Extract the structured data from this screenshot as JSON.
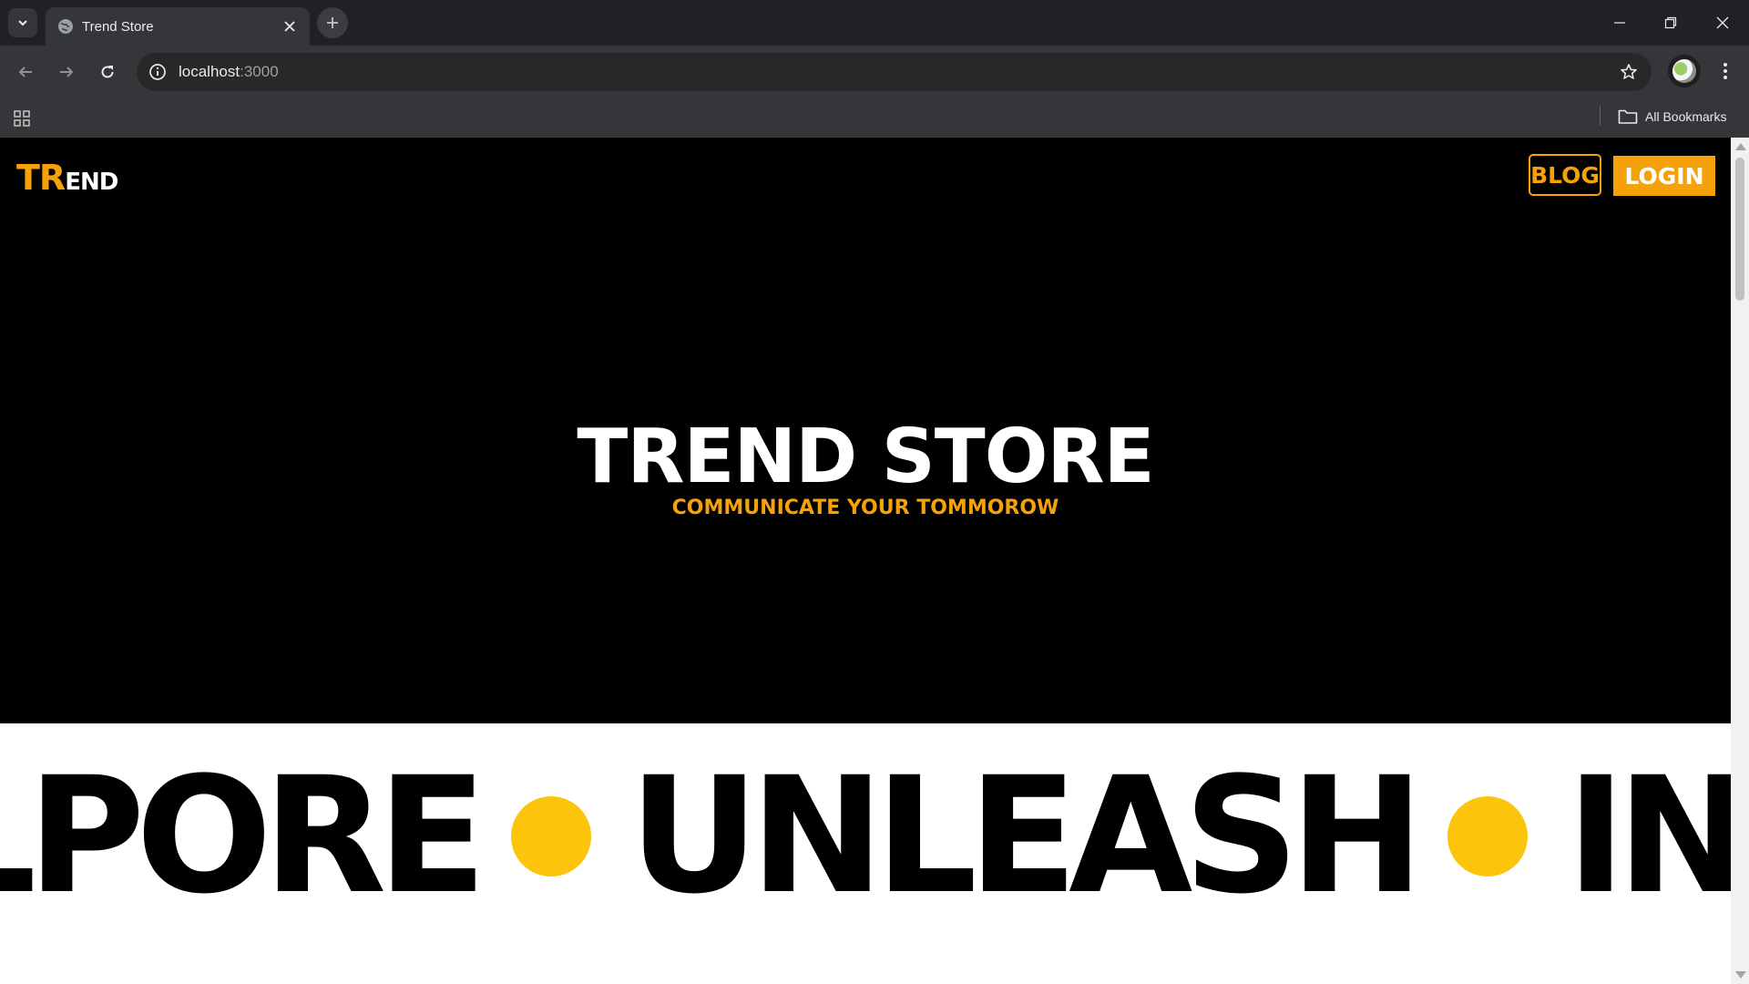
{
  "browser": {
    "tab": {
      "title": "Trend Store",
      "favicon": "globe-icon"
    },
    "url": {
      "host": "localhost",
      "port": ":3000"
    },
    "bookmarks_bar": {
      "all_bookmarks_label": "All Bookmarks"
    },
    "icons": {
      "tab_search": "chevron-down-icon",
      "new_tab": "plus-icon",
      "back": "arrow-left-icon",
      "forward": "arrow-right-icon",
      "reload": "reload-icon",
      "site_info": "info-icon",
      "bookmark_star": "star-icon",
      "menu": "kebab-icon",
      "apps": "apps-grid-icon",
      "folder": "folder-icon"
    }
  },
  "site": {
    "logo": {
      "highlight": "TR",
      "rest": "END"
    },
    "nav": {
      "blog_label": "BLOG",
      "login_label": "LOGIN"
    },
    "hero": {
      "title": "TREND STORE",
      "subtitle": "COMMUNICATE YOUR TOMMOROW"
    },
    "marquee": {
      "words": [
        "LPORE",
        "UNLEASH",
        "IN"
      ]
    },
    "colors": {
      "accent": "#f5a20a",
      "dot": "#fcc40a",
      "hero_bg": "#000000",
      "marquee_bg": "#ffffff"
    }
  }
}
